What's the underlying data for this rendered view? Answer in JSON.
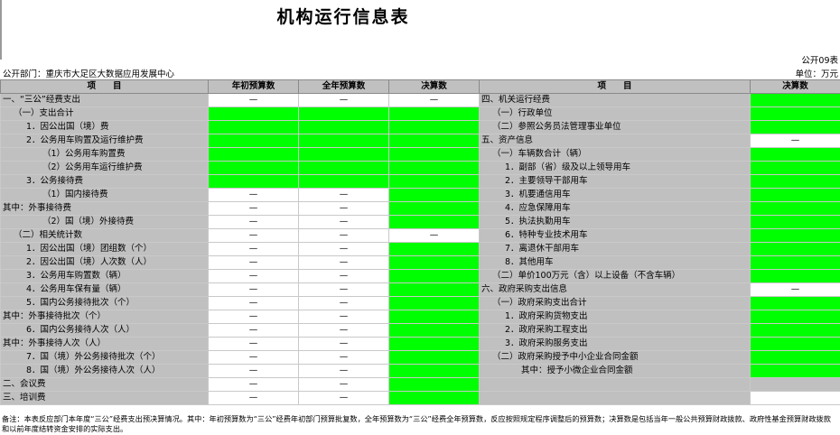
{
  "title": "机构运行信息表",
  "form_no": "公开09表",
  "department": "公开部门：重庆市大足区大数据应用发展中心",
  "unit": "单位：万元",
  "headers": {
    "item": "项　　目",
    "initial_budget": "年初预算数",
    "annual_budget": "全年预算数",
    "final_accounts": "决算数",
    "item_right": "项　　目",
    "final_accounts_right": "决算数"
  },
  "rows": [
    {
      "left": "一、“三公”经费支出",
      "li": 0,
      "cells": [
        "—",
        "—",
        "—"
      ],
      "right": "四、机关运行经费",
      "ri": 0,
      "rv": "g"
    },
    {
      "left": "（一）支出合计",
      "li": 1,
      "cells": [
        "g",
        "g",
        "g"
      ],
      "right": "（一）行政单位",
      "ri": 1,
      "rv": "g"
    },
    {
      "left": "1．因公出国（境）费",
      "li": 2,
      "cells": [
        "g",
        "g",
        "g"
      ],
      "right": "（二）参照公务员法管理事业单位",
      "ri": 1,
      "rv": "g"
    },
    {
      "left": "2．公务用车购置及运行维护费",
      "li": 2,
      "cells": [
        "g",
        "g",
        "g"
      ],
      "right": "五、资产信息",
      "ri": 0,
      "rv": "—"
    },
    {
      "left": "（1）公务用车购置费",
      "li": 3,
      "cells": [
        "g",
        "g",
        "g"
      ],
      "right": "（一）车辆数合计（辆）",
      "ri": 1,
      "rv": "g"
    },
    {
      "left": "（2）公务用车运行维护费",
      "li": 3,
      "cells": [
        "g",
        "g",
        "g"
      ],
      "right": "1．副部（省）级及以上领导用车",
      "ri": 2,
      "rv": "g"
    },
    {
      "left": "3．公务接待费",
      "li": 2,
      "cells": [
        "g",
        "g",
        "g"
      ],
      "right": "2．主要领导干部用车",
      "ri": 2,
      "rv": "g"
    },
    {
      "left": "（1）国内接待费",
      "li": 3,
      "cells": [
        "—",
        "—",
        "g"
      ],
      "right": "3．机要通信用车",
      "ri": 2,
      "rv": "g"
    },
    {
      "left": "其中：外事接待费",
      "li": 4,
      "cells": [
        "—",
        "—",
        "g"
      ],
      "right": "4．应急保障用车",
      "ri": 2,
      "rv": "g"
    },
    {
      "left": "（2）国（境）外接待费",
      "li": 3,
      "cells": [
        "—",
        "—",
        "g"
      ],
      "right": "5．执法执勤用车",
      "ri": 2,
      "rv": "g"
    },
    {
      "left": "（二）相关统计数",
      "li": 1,
      "cells": [
        "—",
        "—",
        "—"
      ],
      "right": "6．特种专业技术用车",
      "ri": 2,
      "rv": "g"
    },
    {
      "left": "1．因公出国（境）团组数（个）",
      "li": 2,
      "cells": [
        "—",
        "—",
        "g"
      ],
      "right": "7．离退休干部用车",
      "ri": 2,
      "rv": "g"
    },
    {
      "left": "2．因公出国（境）人次数（人）",
      "li": 2,
      "cells": [
        "—",
        "—",
        "g"
      ],
      "right": "8．其他用车",
      "ri": 2,
      "rv": "g"
    },
    {
      "left": "3．公务用车购置数（辆）",
      "li": 2,
      "cells": [
        "—",
        "—",
        "g"
      ],
      "right": "（二）单价100万元（含）以上设备（不含车辆）",
      "ri": 1,
      "rv": "g"
    },
    {
      "left": "4．公务用车保有量（辆）",
      "li": 2,
      "cells": [
        "—",
        "—",
        "g"
      ],
      "right": "六、政府采购支出信息",
      "ri": 0,
      "rv": "—"
    },
    {
      "left": "5．国内公务接待批次（个）",
      "li": 2,
      "cells": [
        "—",
        "—",
        "g"
      ],
      "right": "（一）政府采购支出合计",
      "ri": 1,
      "rv": "g"
    },
    {
      "left": "其中：外事接待批次（个）",
      "li": 4,
      "cells": [
        "—",
        "—",
        "g"
      ],
      "right": "1．政府采购货物支出",
      "ri": 2,
      "rv": "g"
    },
    {
      "left": "6．国内公务接待人次（人）",
      "li": 2,
      "cells": [
        "—",
        "—",
        "g"
      ],
      "right": "2．政府采购工程支出",
      "ri": 2,
      "rv": "g"
    },
    {
      "left": "其中：外事接待人次（人）",
      "li": 4,
      "cells": [
        "—",
        "—",
        "g"
      ],
      "right": "3．政府采购服务支出",
      "ri": 2,
      "rv": "g"
    },
    {
      "left": "7．国（境）外公务接待批次（个）",
      "li": 2,
      "cells": [
        "—",
        "—",
        "g"
      ],
      "right": "（二）政府采购授予中小企业合同金额",
      "ri": 1,
      "rv": "g"
    },
    {
      "left": "8．国（境）外公务接待人次（人）",
      "li": 2,
      "cells": [
        "—",
        "—",
        "g"
      ],
      "right": "其中：授予小微企业合同金额",
      "ri": 3,
      "rv": "g"
    },
    {
      "left": "二、会议费",
      "li": 0,
      "cells": [
        "—",
        "—",
        "g"
      ],
      "right": "",
      "ri": 0,
      "rv": "lab"
    },
    {
      "left": "三、培训费",
      "li": 0,
      "cells": [
        "—",
        "—",
        "g"
      ],
      "right": "",
      "ri": 0,
      "rv": "n"
    }
  ],
  "note": "备注：本表反应部门本年度“三公”经费支出预决算情况。其中：年初预算数为“三公”经费年初部门预算批复数，全年预算数为“三公”经费全年预算数，反应按照规定程序调整后的预算数；决算数是包括当年一般公共预算财政拨款、政府性基金预算财政拨款和以前年度结转资金安排的实际支出。",
  "colors": {
    "green": "#00ff00",
    "label_gray": "#c0c0c0"
  }
}
